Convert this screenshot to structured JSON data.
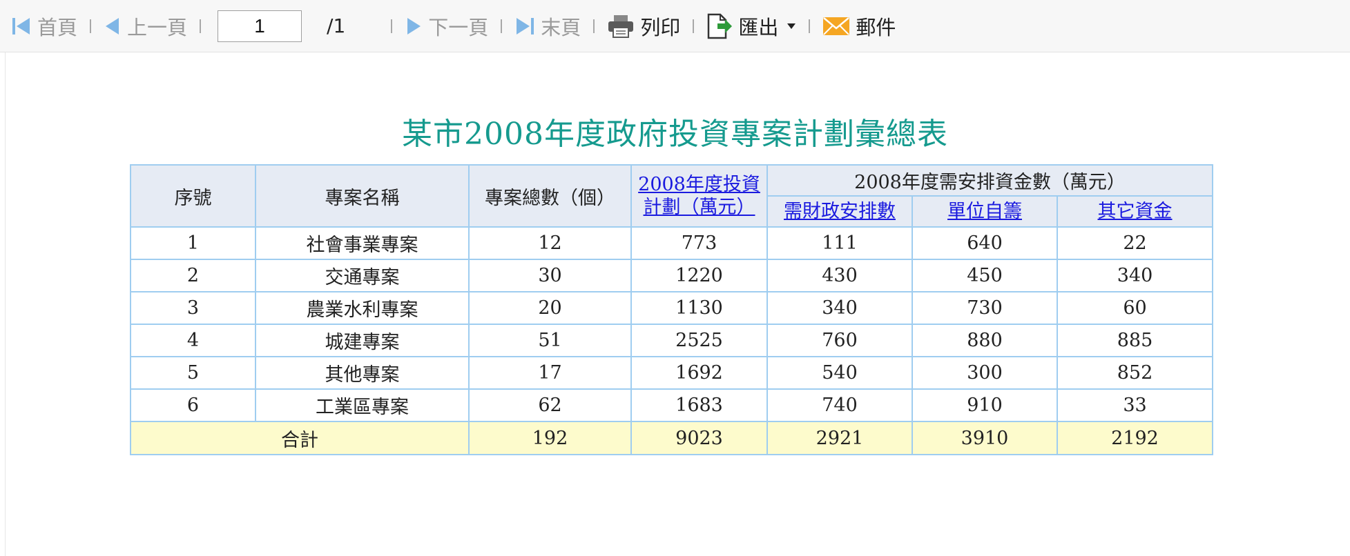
{
  "toolbar": {
    "first_label": "首頁",
    "prev_label": "上一頁",
    "page_value": "1",
    "page_total": "/1",
    "next_label": "下一頁",
    "last_label": "末頁",
    "print_label": "列印",
    "export_label": "匯出",
    "mail_label": "郵件"
  },
  "report": {
    "title": "某市2008年度政府投資專案計劃彙總表",
    "headers": {
      "seq": "序號",
      "name": "專案名稱",
      "count": "專案總數（個）",
      "plan": "2008年度投資計劃（萬元）",
      "group": "2008年度需安排資金數（萬元）",
      "finance": "需財政安排數",
      "self": "單位自籌",
      "other": "其它資金"
    },
    "rows": [
      {
        "seq": "1",
        "name": "社會事業專案",
        "count": "12",
        "plan": "773",
        "finance": "111",
        "self": "640",
        "other": "22"
      },
      {
        "seq": "2",
        "name": "交通專案",
        "count": "30",
        "plan": "1220",
        "finance": "430",
        "self": "450",
        "other": "340"
      },
      {
        "seq": "3",
        "name": "農業水利專案",
        "count": "20",
        "plan": "1130",
        "finance": "340",
        "self": "730",
        "other": "60"
      },
      {
        "seq": "4",
        "name": "城建專案",
        "count": "51",
        "plan": "2525",
        "finance": "760",
        "self": "880",
        "other": "885"
      },
      {
        "seq": "5",
        "name": "其他專案",
        "count": "17",
        "plan": "1692",
        "finance": "540",
        "self": "300",
        "other": "852"
      },
      {
        "seq": "6",
        "name": "工業區專案",
        "count": "62",
        "plan": "1683",
        "finance": "740",
        "self": "910",
        "other": "33"
      }
    ],
    "total": {
      "label": "合計",
      "count": "192",
      "plan": "9023",
      "finance": "2921",
      "self": "3910",
      "other": "2192"
    }
  },
  "colors": {
    "title": "#159a8e",
    "header_bg": "#e6ebf4",
    "total_bg": "#fdfbcc",
    "grid": "#9fcdf0",
    "link": "#1a1adf"
  }
}
